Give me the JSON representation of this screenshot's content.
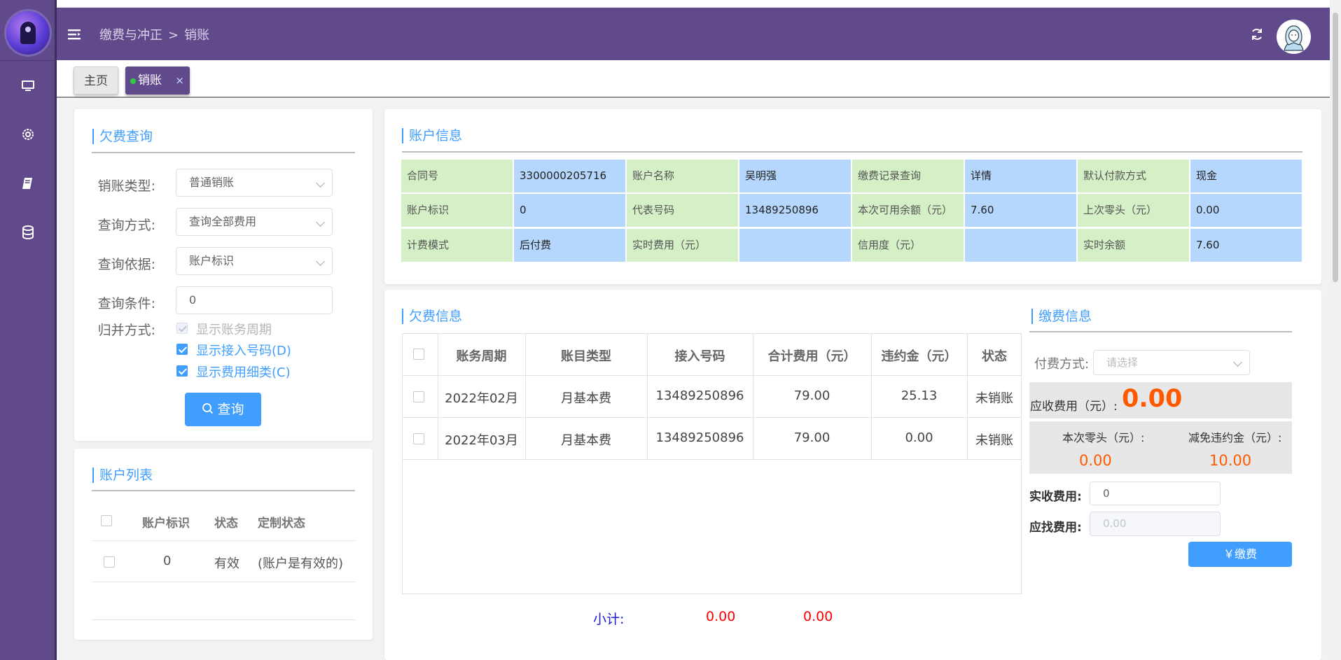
{
  "header": {
    "breadcrumb": [
      "缴费与冲正",
      "销账"
    ],
    "breadcrumb_sep": ">"
  },
  "tabs": [
    {
      "label": "主页"
    },
    {
      "label": "销账",
      "close": "×"
    }
  ],
  "sidebar": {
    "items": [
      {
        "icon": "monitor-icon"
      },
      {
        "icon": "gear-icon"
      },
      {
        "icon": "book-icon"
      },
      {
        "icon": "database-icon"
      }
    ]
  },
  "query": {
    "title": "欠费查询",
    "fields": [
      {
        "label": "销账类型:",
        "value": "普通销账"
      },
      {
        "label": "查询方式:",
        "value": "查询全部费用"
      },
      {
        "label": "查询依据:",
        "value": "账户标识"
      },
      {
        "label": "查询条件:",
        "value": "0"
      }
    ],
    "merge_label": "归并方式:",
    "options": [
      {
        "label": "显示账务周期",
        "checked": true,
        "disabled": true
      },
      {
        "label": "显示接入号码(D)",
        "checked": true,
        "disabled": false
      },
      {
        "label": "显示费用细类(C)",
        "checked": true,
        "disabled": false
      }
    ],
    "button": "查询"
  },
  "account_list": {
    "title": "账户列表",
    "columns": [
      "账户标识",
      "状态",
      "定制状态"
    ],
    "rows": [
      {
        "id": "0",
        "status": "有效",
        "custom": "(账户是有效的)"
      }
    ]
  },
  "account_info": {
    "title": "账户信息",
    "rows": [
      [
        "合同号",
        "3300000205716",
        "账户名称",
        "吴明强",
        "缴费记录查询",
        "详情",
        "默认付款方式",
        "现金"
      ],
      [
        "账户标识",
        "0",
        "代表号码",
        "13489250896",
        "本次可用余额（元）",
        "7.60",
        "上次零头（元）",
        "0.00"
      ],
      [
        "计费模式",
        "后付费",
        "实时费用（元）",
        "",
        "信用度（元）",
        "",
        "实时余额",
        "7.60"
      ]
    ]
  },
  "arrears": {
    "title": "欠费信息",
    "columns": [
      "账务周期",
      "账目类型",
      "接入号码",
      "合计费用（元）",
      "违约金（元）",
      "状态"
    ],
    "rows": [
      [
        "2022年02月",
        "月基本费",
        "13489250896",
        "79.00",
        "25.13",
        "未销账"
      ],
      [
        "2022年03月",
        "月基本费",
        "13489250896",
        "79.00",
        "0.00",
        "未销账"
      ]
    ],
    "subtotal_label": "小计:",
    "subtotal_total": "0.00",
    "subtotal_penalty": "0.00"
  },
  "payment": {
    "title": "缴费信息",
    "method_label": "付费方式:",
    "method_placeholder": "请选择",
    "due_label": "应收费用（元）:",
    "due_value": "0.00",
    "change_label": "本次零头（元）:",
    "change_value": "0.00",
    "waive_label": "减免违约金（元）:",
    "waive_value": "10.00",
    "received_label": "实收费用:",
    "received_value": "0",
    "refund_label": "应找费用:",
    "refund_placeholder": "0.00",
    "button": "￥缴费"
  },
  "colors": {
    "brand": "#604a8c",
    "accent": "#409eff",
    "cell_green": "#d5efc6",
    "cell_blue": "#b5d7fd",
    "amount_orange": "#ff5a00"
  }
}
